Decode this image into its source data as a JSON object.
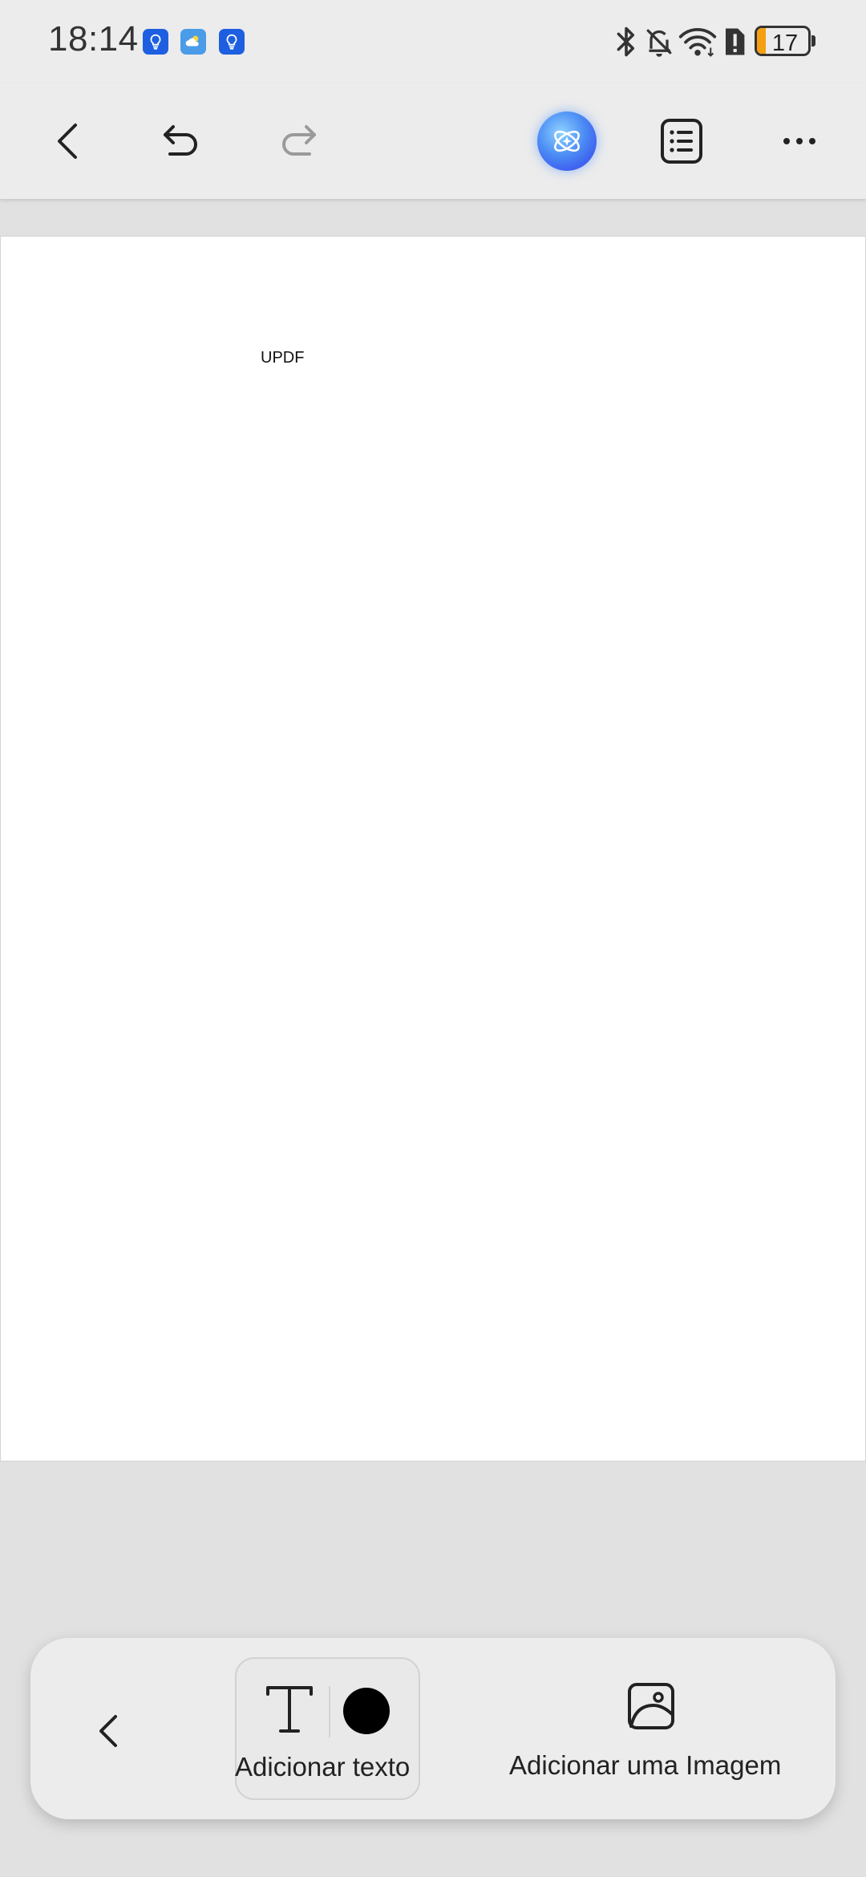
{
  "status_bar": {
    "time": "18:14",
    "notification_icons": [
      "bulb-app-icon",
      "weather-icon",
      "bulb-app-icon"
    ],
    "system_icons": [
      "bluetooth-icon",
      "mute-bell-icon",
      "wifi-icon",
      "sim-alert-icon"
    ],
    "battery": {
      "level": "17",
      "fraction": 0.17,
      "color": "#f5a012"
    }
  },
  "toolbar": {
    "icons": [
      "back-icon",
      "undo-icon",
      "redo-icon",
      "ai-assistant-icon",
      "outline-list-icon",
      "more-icon"
    ]
  },
  "page": {
    "text": "UPDF"
  },
  "bottom_panel": {
    "add_text_label": "Adicionar texto",
    "add_image_label": "Adicionar uma Imagem",
    "text_color": "#000000"
  }
}
